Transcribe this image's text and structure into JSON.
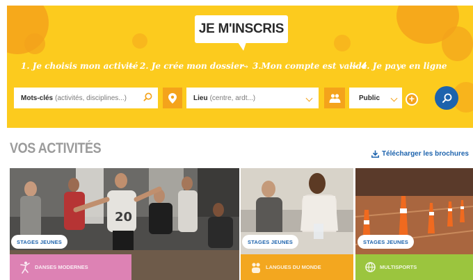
{
  "banner": {
    "headline": "JE M'INSCRIS",
    "steps": [
      "1. Je choisis mon activité",
      "2. Je crée mon dossier",
      "3.Mon compte est validé",
      "4. Je paye en ligne"
    ],
    "step_arrow": "⤳"
  },
  "search": {
    "keywords_label": "Mots-clés",
    "keywords_hint": "(activités, disciplines...)",
    "place_label": "Lieu",
    "place_hint": "(centre, ardt...)",
    "audience_value": "Public",
    "add_label": "+"
  },
  "section": {
    "title": "VOS ACTIVITÉS",
    "download_label": "Télécharger les brochures"
  },
  "cards": [
    {
      "tag": "STAGES JEUNES",
      "label": "DANSES MODERNES",
      "strip_color": "#dd82b4"
    },
    {
      "tag": "STAGES JEUNES",
      "label": "LANGUES DU MONDE",
      "strip_color": "#f3a71f"
    },
    {
      "tag": "STAGES JEUNES",
      "label": "MULTISPORTS",
      "strip_color": "#9bc53e"
    }
  ],
  "colors": {
    "banner": "#fccb1e",
    "accent_orange": "#f4a31b",
    "brand_blue": "#1d63ad"
  },
  "icons": [
    "search-icon",
    "map-pin-icon",
    "people-icon",
    "plus-icon",
    "download-icon",
    "dancer-icon",
    "people-icon",
    "ball-icon"
  ]
}
